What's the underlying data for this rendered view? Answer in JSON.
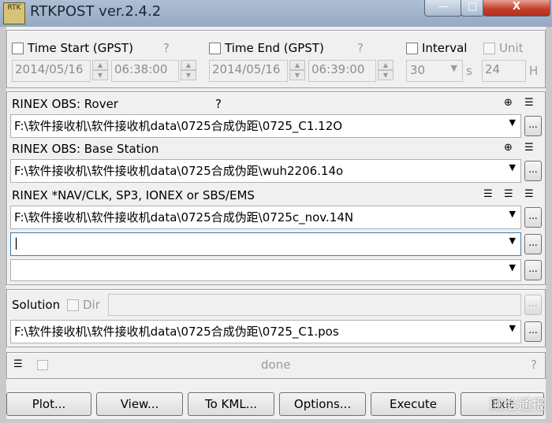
{
  "window": {
    "title": "RTKPOST ver.2.4.2",
    "app_icon_text": "RTK",
    "min_label": "—",
    "max_label": "□",
    "close_label": "X"
  },
  "time": {
    "start_label": "Time Start (GPST)",
    "start_help": "?",
    "start_date": "2014/05/16",
    "start_time": "06:38:00",
    "end_label": "Time End (GPST)",
    "end_help": "?",
    "end_date": "2014/05/16",
    "end_time": "06:39:00",
    "interval_label": "Interval",
    "interval_value": "30",
    "interval_unit": "s",
    "unit_label": "Unit",
    "unit_value": "24",
    "unit_suffix": "H"
  },
  "inputs": {
    "rover_label": "RINEX OBS: Rover",
    "rover_help": "?",
    "rover_path": "F:\\软件接收机\\软件接收机data\\0725合成伪距\\0725_C1.12O",
    "base_label": "RINEX OBS: Base Station",
    "base_path": "F:\\软件接收机\\软件接收机data\\0725合成伪距\\wuh2206.14o",
    "nav_label": "RINEX *NAV/CLK, SP3, IONEX or SBS/EMS",
    "nav_path": "F:\\软件接收机\\软件接收机data\\0725合成伪距\\0725c_nov.14N",
    "nav_path2": "|",
    "nav_path3": "",
    "browse_label": "..."
  },
  "solution": {
    "label": "Solution",
    "dir_label": "Dir",
    "dir_value": "",
    "output_path": "F:\\软件接收机\\软件接收机data\\0725合成伪距\\0725_C1.pos"
  },
  "status": {
    "message": "done",
    "help": "?"
  },
  "buttons": {
    "plot": "Plot...",
    "view": "View...",
    "kml": "To KML...",
    "options": "Options...",
    "execute": "Execute",
    "exit": "Exit"
  },
  "watermark": "测绘通报",
  "icons": [
    "globe-icon",
    "list-icon",
    "dropdown-arrow-icon",
    "checkbox-icon"
  ]
}
